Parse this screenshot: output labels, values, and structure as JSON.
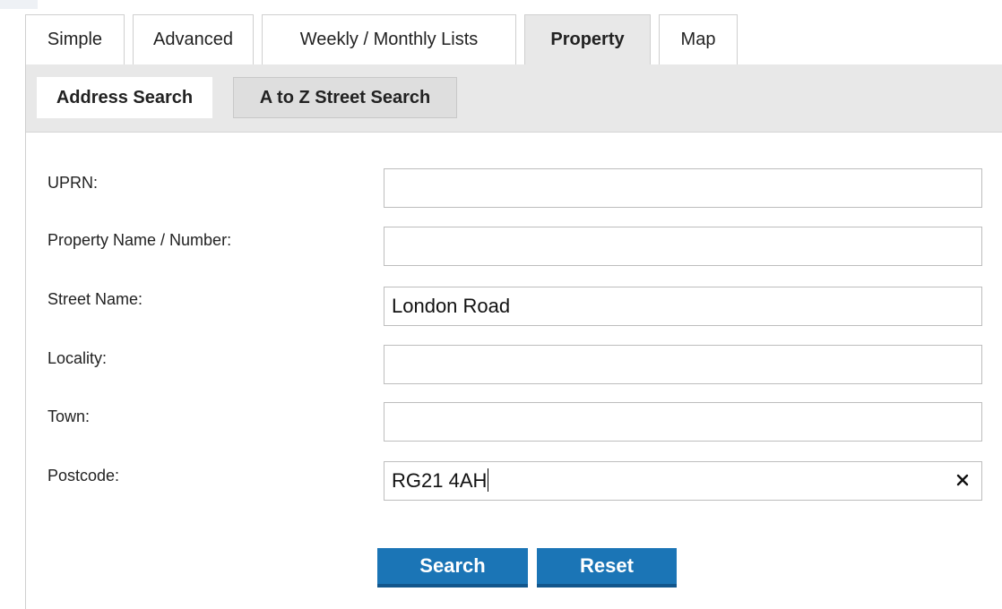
{
  "tabs": [
    {
      "label": "Simple",
      "active": false
    },
    {
      "label": "Advanced",
      "active": false
    },
    {
      "label": "Weekly / Monthly Lists",
      "active": false
    },
    {
      "label": "Property",
      "active": true
    },
    {
      "label": "Map",
      "active": false
    }
  ],
  "subtabs": [
    {
      "label": "Address Search",
      "active": true
    },
    {
      "label": "A to Z Street Search",
      "active": false
    }
  ],
  "form": {
    "uprn": {
      "label": "UPRN:",
      "value": ""
    },
    "property_name": {
      "label": "Property Name / Number:",
      "value": ""
    },
    "street_name": {
      "label": "Street Name:",
      "value": "London Road"
    },
    "locality": {
      "label": "Locality:",
      "value": ""
    },
    "town": {
      "label": "Town:",
      "value": ""
    },
    "postcode": {
      "label": "Postcode:",
      "value": "RG21 4AH",
      "clear_icon": "close-icon"
    }
  },
  "buttons": {
    "search_label": "Search",
    "reset_label": "Reset"
  },
  "colors": {
    "button": "#1b75b6",
    "active_tab": "#e8e8e8"
  }
}
